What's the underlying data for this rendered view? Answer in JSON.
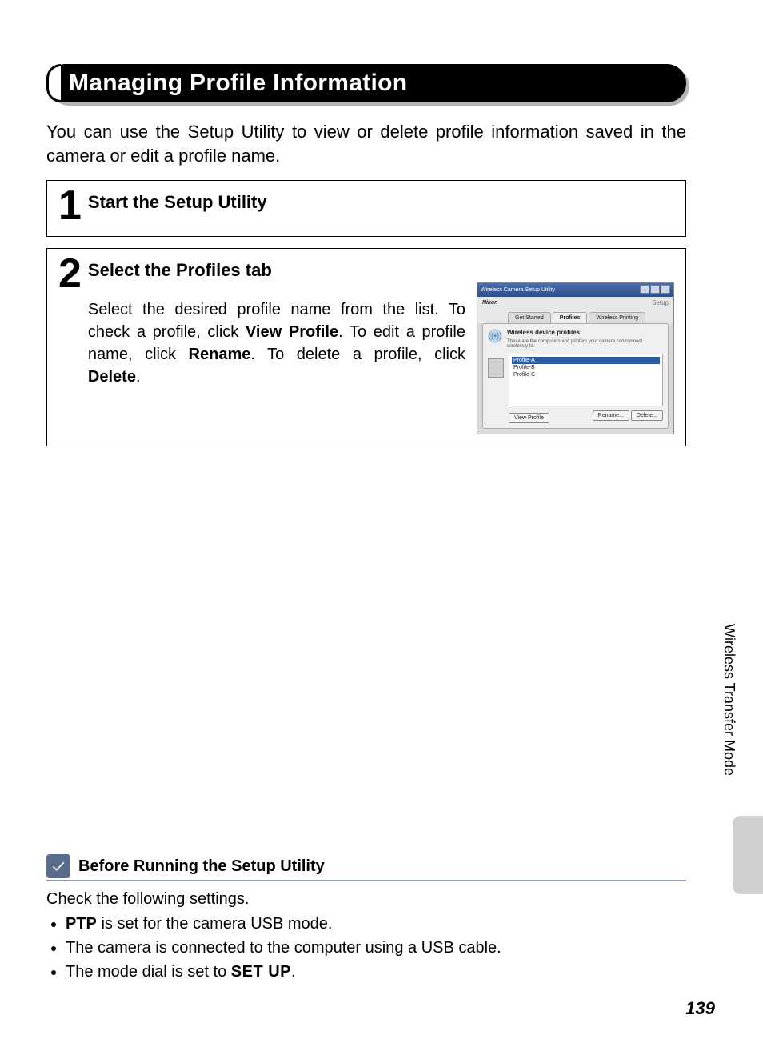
{
  "heading": "Managing Profile Information",
  "intro": "You can use the Setup Utility to view or delete profile information saved in the camera or edit a profile name.",
  "steps": {
    "s1": {
      "num": "1",
      "title": "Start the Setup Utility"
    },
    "s2": {
      "num": "2",
      "title": "Select the Profiles tab",
      "text_parts": {
        "a": "Select the desired profile name from the list. To check a profile, click ",
        "b": "View Profile",
        "c": ". To edit a profile name, click ",
        "d": "Rename",
        "e": ". To delete a profile, click ",
        "f": "Delete",
        "g": "."
      }
    }
  },
  "shot": {
    "wintitle": "Wireless Camera Setup Utility",
    "brand": "Nikon",
    "setup": "Setup",
    "tabs": {
      "a": "Get Started",
      "b": "Profiles",
      "c": "Wireless Printing"
    },
    "panel_title": "Wireless device profiles",
    "panel_sub": "These are the computers and printers your camera can connect wirelessly to.",
    "items": {
      "a": "Profile-A",
      "b": "Profile-B",
      "c": "Profile-C"
    },
    "btns": {
      "view": "View Profile",
      "rename": "Rename...",
      "delete": "Delete..."
    }
  },
  "note": {
    "title": "Before Running the Setup Utility",
    "lead": "Check the following settings.",
    "li1": {
      "b": "PTP",
      "rest": " is set for the camera USB mode."
    },
    "li2": "The camera is connected to the computer using a USB cable.",
    "li3": {
      "a": "The mode dial is set to ",
      "b": "SET UP",
      "c": "."
    }
  },
  "side_label": "Wireless Transfer Mode",
  "page_number": "139"
}
